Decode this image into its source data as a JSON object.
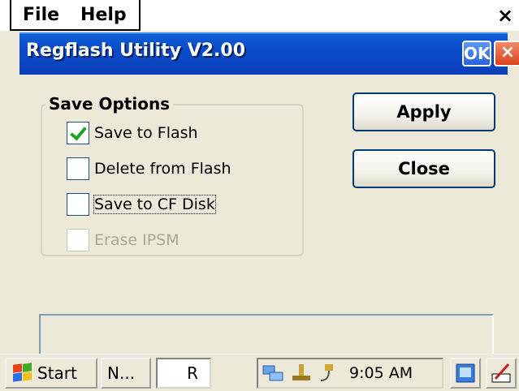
{
  "menubar": {
    "file_label": "File",
    "help_label": "Help",
    "close_glyph": "×"
  },
  "dialog": {
    "title": "Regflash Utility V2.00",
    "ok_label": "OK",
    "close_glyph": "×",
    "group_title": "Save Options",
    "options": [
      {
        "label": "Save to Flash",
        "checked": true,
        "enabled": true
      },
      {
        "label": "Delete from Flash",
        "checked": false,
        "enabled": true
      },
      {
        "label": "Save to CF Disk",
        "checked": false,
        "enabled": true
      },
      {
        "label": "Erase IPSM",
        "checked": false,
        "enabled": false
      }
    ],
    "apply_label": "Apply",
    "close_label": "Close"
  },
  "taskbar": {
    "start_label": "Start",
    "task1_label": "N...",
    "task2_label": "R",
    "clock": "9:05 AM"
  },
  "icons": {
    "start": "windows-flag-icon",
    "tray1": "network-icon",
    "tray2": "usb-icon",
    "tray3": "power-icon",
    "desktop": "desktop-icon",
    "input": "pen-input-icon"
  }
}
